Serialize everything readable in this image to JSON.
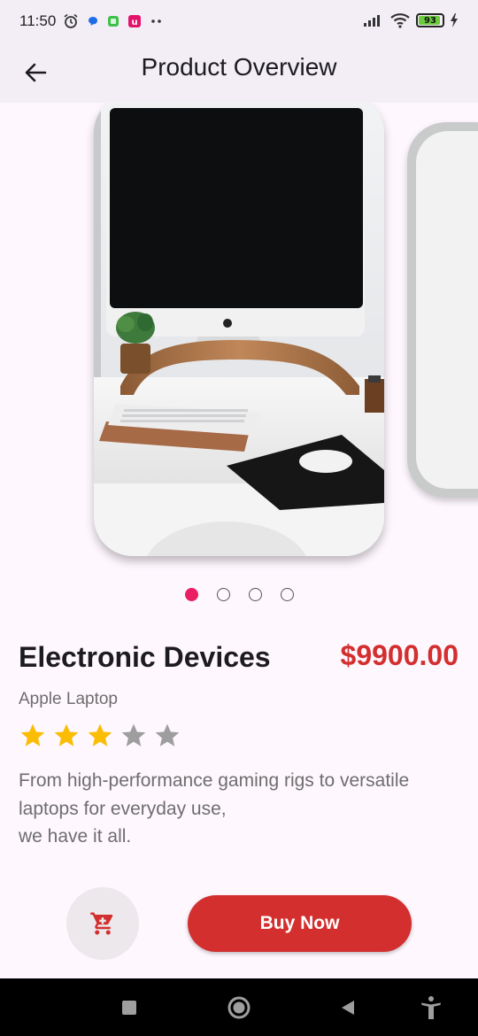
{
  "status_bar": {
    "time": "11:50",
    "battery_level": 93,
    "battery_text": "93",
    "icons": [
      "alarm-icon",
      "messenger-icon",
      "app-icon-green",
      "app-icon-pink",
      "more-dots-icon",
      "signal-icon",
      "wifi-icon",
      "battery-icon",
      "charging-icon"
    ]
  },
  "app_bar": {
    "title": "Product Overview",
    "back_icon": "back-arrow-icon"
  },
  "carousel": {
    "page_count": 4,
    "active_index": 0
  },
  "product": {
    "name": "Electronic Devices",
    "price": "$9900.00",
    "subtitle": "Apple Laptop",
    "rating": 3,
    "rating_max": 5,
    "description_lines": [
      "From high-performance gaming rigs to versatile",
      "laptops for everyday use,",
      "we have it all."
    ]
  },
  "actions": {
    "cart_icon": "cart-icon",
    "buy_label": "Buy Now"
  },
  "colors": {
    "accent": "#d32f2f",
    "dot_active": "#e91e63",
    "star_filled": "#fbbc04",
    "star_empty": "#9e9e9e"
  },
  "nav_bar": {
    "icons": [
      "recents-icon",
      "home-icon",
      "back-icon",
      "accessibility-icon"
    ]
  }
}
